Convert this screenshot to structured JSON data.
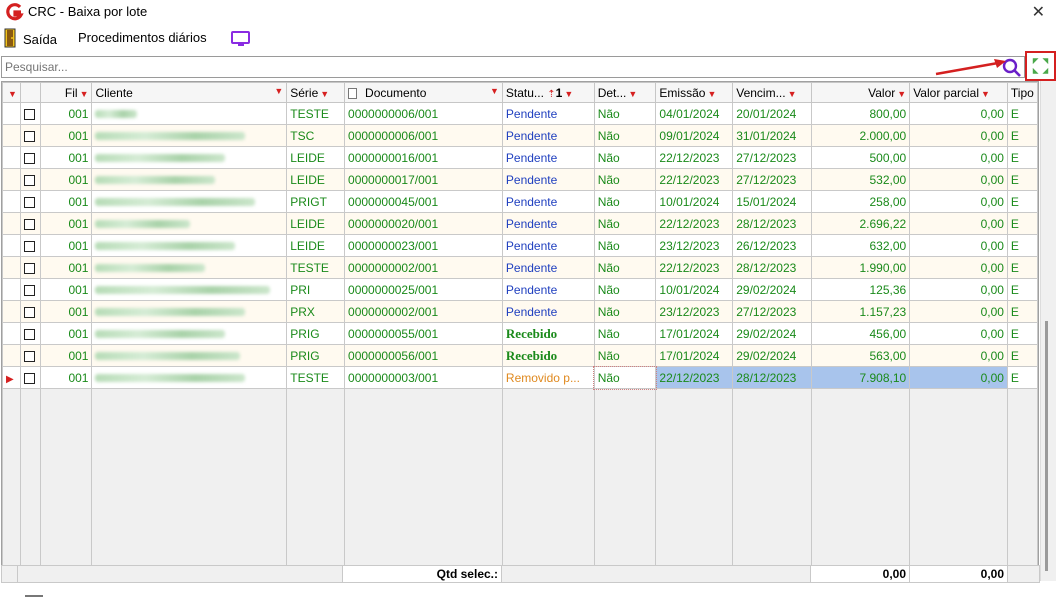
{
  "window": {
    "title": "CRC - Baixa por lote",
    "close": "✕"
  },
  "menu": {
    "exit_label": "Saída",
    "daily_label": "Procedimentos diários"
  },
  "search": {
    "placeholder": "Pesquisar..."
  },
  "columns": {
    "fil": "Fil",
    "cliente": "Cliente",
    "serie": "Série",
    "documento": "Documento",
    "status": "Statu...",
    "status_sort": "1",
    "det": "Det...",
    "emissao": "Emissão",
    "vencimento": "Vencim...",
    "valor": "Valor",
    "valor_parcial": "Valor parcial",
    "tipo": "Tipo"
  },
  "rows": [
    {
      "fil": "001",
      "serie": "TESTE",
      "doc": "0000000006/001",
      "status": "Pendente",
      "det": "Não",
      "emissao": "04/01/2024",
      "venc": "20/01/2024",
      "valor": "800,00",
      "parcial": "0,00",
      "tipo": "E"
    },
    {
      "fil": "001",
      "serie": "TSC",
      "doc": "0000000006/001",
      "status": "Pendente",
      "det": "Não",
      "emissao": "09/01/2024",
      "venc": "31/01/2024",
      "valor": "2.000,00",
      "parcial": "0,00",
      "tipo": "E"
    },
    {
      "fil": "001",
      "serie": "LEIDE",
      "doc": "0000000016/001",
      "status": "Pendente",
      "det": "Não",
      "emissao": "22/12/2023",
      "venc": "27/12/2023",
      "valor": "500,00",
      "parcial": "0,00",
      "tipo": "E"
    },
    {
      "fil": "001",
      "serie": "LEIDE",
      "doc": "0000000017/001",
      "status": "Pendente",
      "det": "Não",
      "emissao": "22/12/2023",
      "venc": "27/12/2023",
      "valor": "532,00",
      "parcial": "0,00",
      "tipo": "E"
    },
    {
      "fil": "001",
      "serie": "PRIGT",
      "doc": "0000000045/001",
      "status": "Pendente",
      "det": "Não",
      "emissao": "10/01/2024",
      "venc": "15/01/2024",
      "valor": "258,00",
      "parcial": "0,00",
      "tipo": "E"
    },
    {
      "fil": "001",
      "serie": "LEIDE",
      "doc": "0000000020/001",
      "status": "Pendente",
      "det": "Não",
      "emissao": "22/12/2023",
      "venc": "28/12/2023",
      "valor": "2.696,22",
      "parcial": "0,00",
      "tipo": "E"
    },
    {
      "fil": "001",
      "serie": "LEIDE",
      "doc": "0000000023/001",
      "status": "Pendente",
      "det": "Não",
      "emissao": "23/12/2023",
      "venc": "26/12/2023",
      "valor": "632,00",
      "parcial": "0,00",
      "tipo": "E"
    },
    {
      "fil": "001",
      "serie": "TESTE",
      "doc": "0000000002/001",
      "status": "Pendente",
      "det": "Não",
      "emissao": "22/12/2023",
      "venc": "28/12/2023",
      "valor": "1.990,00",
      "parcial": "0,00",
      "tipo": "E"
    },
    {
      "fil": "001",
      "serie": "PRI",
      "doc": "0000000025/001",
      "status": "Pendente",
      "det": "Não",
      "emissao": "10/01/2024",
      "venc": "29/02/2024",
      "valor": "125,36",
      "parcial": "0,00",
      "tipo": "E"
    },
    {
      "fil": "001",
      "serie": "PRX",
      "doc": "0000000002/001",
      "status": "Pendente",
      "det": "Não",
      "emissao": "23/12/2023",
      "venc": "27/12/2023",
      "valor": "1.157,23",
      "parcial": "0,00",
      "tipo": "E"
    },
    {
      "fil": "001",
      "serie": "PRIG",
      "doc": "0000000055/001",
      "status": "Recebido",
      "det": "Não",
      "emissao": "17/01/2024",
      "venc": "29/02/2024",
      "valor": "456,00",
      "parcial": "0,00",
      "tipo": "E"
    },
    {
      "fil": "001",
      "serie": "PRIG",
      "doc": "0000000056/001",
      "status": "Recebido",
      "det": "Não",
      "emissao": "17/01/2024",
      "venc": "29/02/2024",
      "valor": "563,00",
      "parcial": "0,00",
      "tipo": "E"
    },
    {
      "fil": "001",
      "serie": "TESTE",
      "doc": "0000000003/001",
      "status": "Removido p...",
      "det": "Não",
      "emissao": "22/12/2023",
      "venc": "28/12/2023",
      "valor": "7.908,10",
      "parcial": "0,00",
      "tipo": "E"
    }
  ],
  "footer": {
    "qtd_label": "Qtd selec.:",
    "total_valor": "0,00",
    "total_parcial": "0,00"
  },
  "colors": {
    "filter": "#d62020",
    "pending": "#1f3fbf",
    "received": "#1a8a1a",
    "removed": "#e08a20",
    "annotation": "#d42020"
  },
  "icons": [
    "app-logo-icon",
    "exit-door-icon",
    "monitor-icon",
    "search-icon",
    "expand-icon",
    "filter-icon",
    "sort-icon",
    "document-icon",
    "row-indicator-icon"
  ]
}
